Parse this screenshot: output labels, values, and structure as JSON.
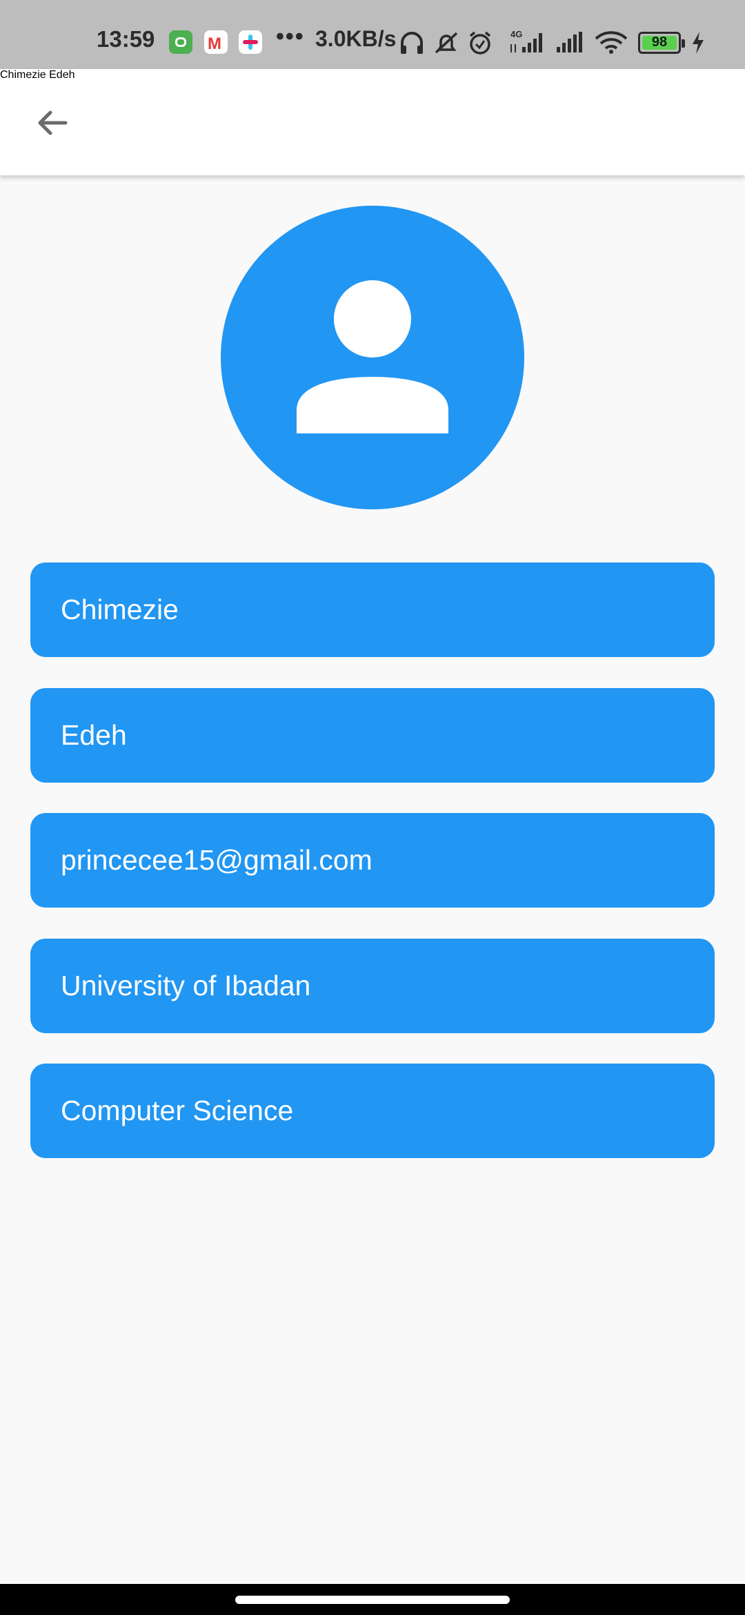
{
  "status_bar": {
    "time": "13:59",
    "net_speed": "3.0KB/s",
    "network_label": "4G",
    "battery_level": "98",
    "icons": [
      "app-notification-icon",
      "gmail-icon",
      "slack-icon",
      "more-dots-icon",
      "headphones-icon",
      "bell-muted-icon",
      "alarm-icon",
      "signal-4g-icon",
      "signal-icon",
      "wifi-icon",
      "battery-icon",
      "charging-icon"
    ]
  },
  "app_bar": {
    "title": "Chimezie Edeh",
    "back_icon": "arrow-back-icon"
  },
  "profile": {
    "avatar_icon": "person-icon",
    "fields": {
      "first_name": "Chimezie",
      "last_name": "Edeh",
      "email": "princecee15@gmail.com",
      "university": "University of Ibadan",
      "department": "Computer Science"
    }
  },
  "colors": {
    "accent": "#2196f3",
    "background": "#f9f9f9",
    "app_bar": "#ffffff",
    "title_text": "#757575",
    "status_bar": "#bdbdbd"
  }
}
